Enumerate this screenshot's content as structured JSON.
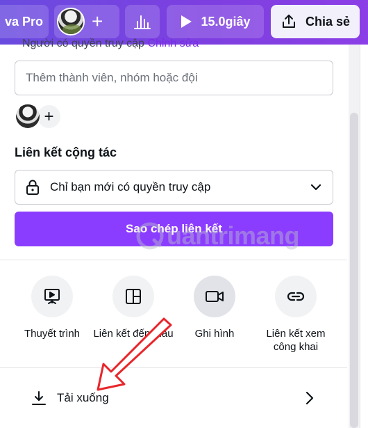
{
  "toolbar": {
    "pro_label": "va Pro",
    "play_duration": "15.0giây",
    "share_label": "Chia sẻ"
  },
  "panel": {
    "access_label": "Người có quyền truy cập",
    "access_edit": "Chỉnh sửa",
    "member_input_placeholder": "Thêm thành viên, nhóm hoặc đội",
    "collab_title": "Liên kết cộng tác",
    "collab_option": "Chỉ bạn mới có quyền truy cập",
    "copy_button": "Sao chép liên kết",
    "options": [
      {
        "label": "Thuyết trình",
        "icon": "presentation-icon"
      },
      {
        "label": "Liên kết đến mẫu",
        "icon": "template-link-icon"
      },
      {
        "label": "Ghi hình",
        "icon": "record-video-icon"
      },
      {
        "label": "Liên kết xem công khai",
        "icon": "public-link-icon"
      }
    ],
    "download_label": "Tải xuống"
  },
  "watermark": "uantrimang",
  "colors": {
    "brand_purple": "#8b3dff",
    "toolbar_start": "#6a4be0",
    "toolbar_end": "#8b3fe6",
    "annotation_red": "#e8262b"
  }
}
